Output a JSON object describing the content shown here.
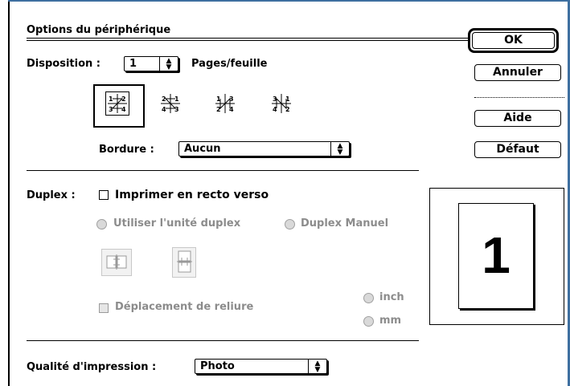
{
  "dialog": {
    "title": "Options du périphérique"
  },
  "disposition": {
    "label": "Disposition :",
    "value": "1",
    "suffix": "Pages/feuille",
    "layouts": [
      {
        "name": "layout-1"
      },
      {
        "name": "layout-2"
      },
      {
        "name": "layout-3"
      },
      {
        "name": "layout-4"
      }
    ],
    "layout_glyphs": {
      "a": [
        "1",
        "2",
        "3",
        "4"
      ],
      "b": [
        "2",
        "1",
        "4",
        "3"
      ],
      "c": [
        "1",
        "3",
        "2",
        "4"
      ],
      "d": [
        "3",
        "1",
        "4",
        "2"
      ]
    }
  },
  "bordure": {
    "label": "Bordure :",
    "value": "Aucun"
  },
  "duplex": {
    "label": "Duplex :",
    "checkbox_label": "Imprimer en recto verso",
    "radio_unit": "Utiliser l'unité duplex",
    "radio_manual": "Duplex Manuel",
    "binding_label": "Déplacement de reliure",
    "unit_inch": "inch",
    "unit_mm": "mm"
  },
  "quality": {
    "label": "Qualité d'impression :",
    "value": "Photo"
  },
  "buttons": {
    "ok": "OK",
    "cancel": "Annuler",
    "help": "Aide",
    "default": "Défaut"
  },
  "preview": {
    "page_number": "1"
  },
  "colors": {
    "frame_blue": "#3e6fa0",
    "disabled_gray": "#8c8c8c"
  }
}
